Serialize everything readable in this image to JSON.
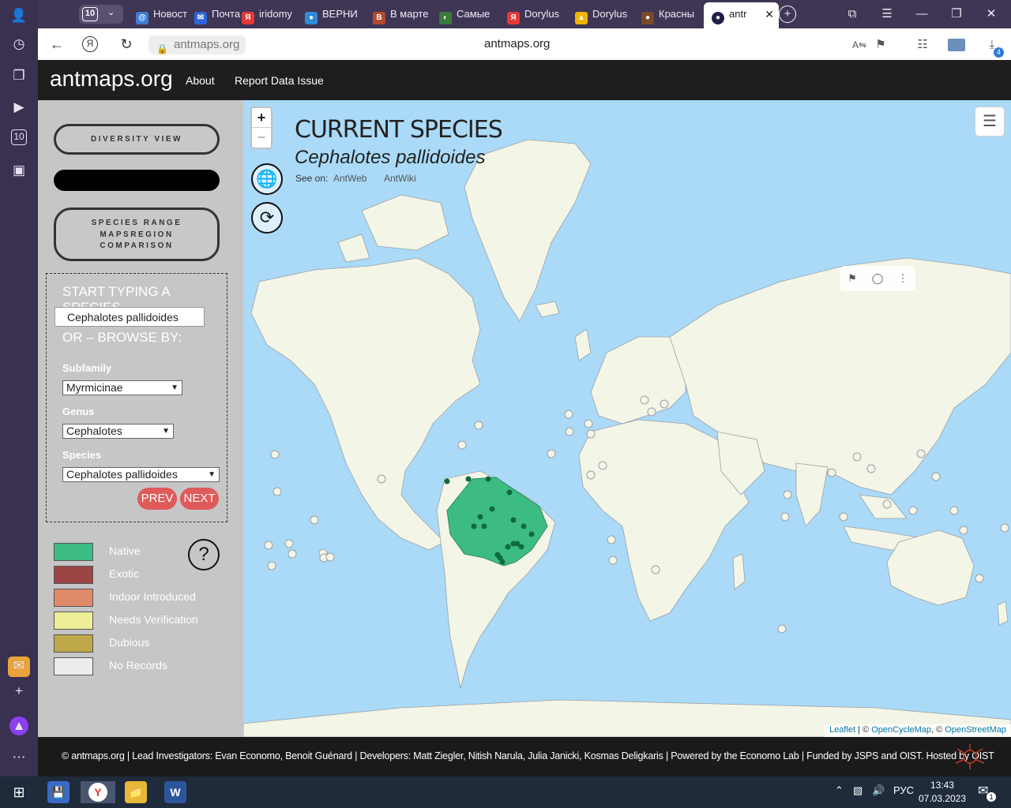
{
  "browser": {
    "tab_count": "10",
    "tabs": [
      {
        "label": "Новост",
        "color": "#3b7dd8",
        "glyph": "@"
      },
      {
        "label": "Почта",
        "color": "#2b66d8",
        "glyph": "✉"
      },
      {
        "label": "iridomy",
        "color": "#e53935",
        "glyph": "Я"
      },
      {
        "label": "ВЕРНИ",
        "color": "#2e8bd6",
        "glyph": "●"
      },
      {
        "label": "В марте",
        "color": "#b24b2a",
        "glyph": "B"
      },
      {
        "label": "Самые",
        "color": "#3a7a3a",
        "glyph": "◐"
      },
      {
        "label": "Dorylus",
        "color": "#e53935",
        "glyph": "Я"
      },
      {
        "label": "Dorylus",
        "color": "#f2b400",
        "glyph": "▲"
      },
      {
        "label": "Красны",
        "color": "#7a4a2a",
        "glyph": "●"
      }
    ],
    "active_tab": "antr",
    "url_pill": "antmaps.org",
    "url_center": "antmaps.org",
    "download_count": "4"
  },
  "site": {
    "logo": "antmaps.org",
    "nav": [
      "About",
      "Report Data Issue"
    ]
  },
  "sidebar": {
    "diversity_view": "DIVERSITY VIEW",
    "species_range_lines": [
      "SPECIES RANGE",
      "MAPSREGION",
      "COMPARISON"
    ],
    "search_heading": "START TYPING A SPECIES",
    "species_input_value": "Cephalotes pallidoides",
    "browse_heading": "OR – BROWSE BY:",
    "subfamily_label": "Subfamily",
    "subfamily_value": "Myrmicinae",
    "genus_label": "Genus",
    "genus_value": "Cephalotes",
    "species_label": "Species",
    "species_value": "Cephalotes pallidoides",
    "prev_label": "PREV",
    "next_label": "NEXT",
    "help_label": "?",
    "legend": [
      {
        "label": "Native",
        "color": "#3dbb84"
      },
      {
        "label": "Exotic",
        "color": "#9b4545"
      },
      {
        "label": "Indoor Introduced",
        "color": "#e08a6a"
      },
      {
        "label": "Needs Verification",
        "color": "#eeee99"
      },
      {
        "label": "Dubious",
        "color": "#bfa94a"
      },
      {
        "label": "No Records",
        "color": "#ececec"
      }
    ]
  },
  "map": {
    "zoom_in": "+",
    "zoom_out": "−",
    "title": "CURRENT SPECIES",
    "species": "Cephalotes pallidoides",
    "see_on": "See on:",
    "links": [
      "AntWeb",
      "AntWiki"
    ],
    "attribution_leaflet": "Leaflet",
    "attribution_sep1": " | © ",
    "attribution_ocm": "OpenCycleMap",
    "attribution_sep2": ", © ",
    "attribution_osm": "OpenStreetMap"
  },
  "footer": {
    "text": "© antmaps.org | Lead Investigators: Evan Economo, Benoit Guénard | Developers: Matt Ziegler, Nitish Narula, Julia Janicki, Kosmas Deligkaris | Powered by the Economo Lab | Funded by JSPS and OIST. Hosted by OIST"
  },
  "taskbar": {
    "lang": "РУС",
    "time": "13:43",
    "date": "07.03.2023",
    "notif_count": "1"
  }
}
